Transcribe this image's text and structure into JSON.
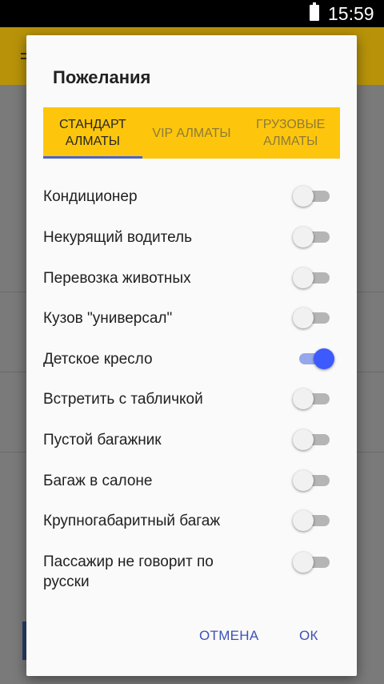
{
  "status_bar": {
    "time": "15:59",
    "battery_icon": "battery-icon"
  },
  "dialog": {
    "title": "Пожелания",
    "tabs": [
      {
        "label": "СТАНДАРТ АЛМАТЫ",
        "active": true
      },
      {
        "label": "VIP АЛМАТЫ",
        "active": false
      },
      {
        "label": "ГРУЗОВЫЕ АЛМАТЫ",
        "active": false
      }
    ],
    "options": [
      {
        "label": "Кондиционер",
        "checked": false
      },
      {
        "label": "Некурящий водитель",
        "checked": false
      },
      {
        "label": "Перевозка животных",
        "checked": false
      },
      {
        "label": "Кузов \"универсал\"",
        "checked": false
      },
      {
        "label": "Детское кресло",
        "checked": true
      },
      {
        "label": "Встретить с табличкой",
        "checked": false
      },
      {
        "label": "Пустой багажник",
        "checked": false
      },
      {
        "label": "Багаж в салоне",
        "checked": false
      },
      {
        "label": "Крупногабаритный багаж",
        "checked": false
      },
      {
        "label": "Пассажир не говорит по русски",
        "checked": false
      }
    ],
    "buttons": {
      "cancel": "ОТМЕНА",
      "ok": "ОК"
    }
  },
  "colors": {
    "accent": "#3d5afe",
    "tab_bar": "#fdc60c",
    "app_bar": "#b8930a"
  }
}
